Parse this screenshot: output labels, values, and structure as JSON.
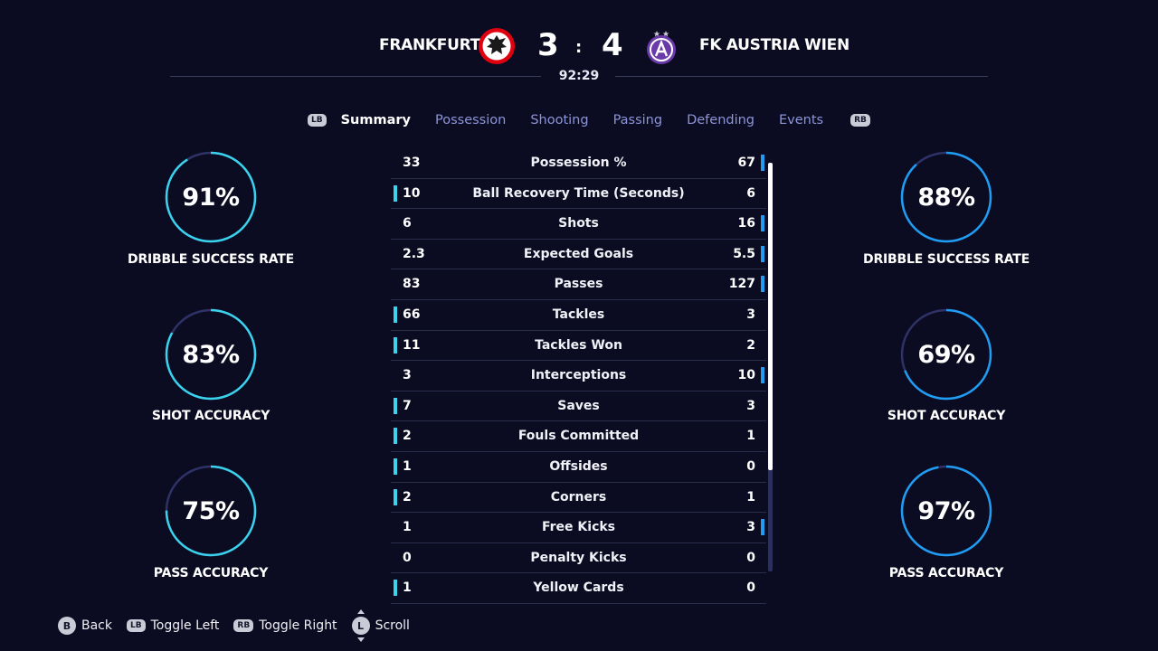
{
  "match": {
    "home_team": "FRANKFURT",
    "away_team": "FK AUSTRIA WIEN",
    "home_score": "3",
    "separator": ":",
    "away_score": "4",
    "clock": "92:29",
    "home_crest_icon": "eagle-crest-icon",
    "away_crest_icon": "violet-crest-icon"
  },
  "tabs": {
    "left_shoulder": "LB",
    "right_shoulder": "RB",
    "items": [
      "Summary",
      "Possession",
      "Shooting",
      "Passing",
      "Defending",
      "Events"
    ],
    "active": "Summary"
  },
  "colors": {
    "background": "#0b0b21",
    "home_accent": "#3ad3ee",
    "away_accent": "#1f9df2",
    "tab_inactive": "#8c95d9",
    "ring_track": "#2f3266"
  },
  "home_rings": [
    {
      "value": "91%",
      "label": "DRIBBLE SUCCESS RATE",
      "fraction": 0.91
    },
    {
      "value": "83%",
      "label": "SHOT ACCURACY",
      "fraction": 0.83
    },
    {
      "value": "75%",
      "label": "PASS ACCURACY",
      "fraction": 0.75
    }
  ],
  "away_rings": [
    {
      "value": "88%",
      "label": "DRIBBLE SUCCESS RATE",
      "fraction": 0.88
    },
    {
      "value": "69%",
      "label": "SHOT ACCURACY",
      "fraction": 0.69
    },
    {
      "value": "97%",
      "label": "PASS ACCURACY",
      "fraction": 0.97
    }
  ],
  "stats": [
    {
      "name": "Possession %",
      "home": "33",
      "away": "67",
      "leader": "away"
    },
    {
      "name": "Ball Recovery Time (Seconds)",
      "home": "10",
      "away": "6",
      "leader": "home"
    },
    {
      "name": "Shots",
      "home": "6",
      "away": "16",
      "leader": "away"
    },
    {
      "name": "Expected Goals",
      "home": "2.3",
      "away": "5.5",
      "leader": "away"
    },
    {
      "name": "Passes",
      "home": "83",
      "away": "127",
      "leader": "away"
    },
    {
      "name": "Tackles",
      "home": "66",
      "away": "3",
      "leader": "home"
    },
    {
      "name": "Tackles Won",
      "home": "11",
      "away": "2",
      "leader": "home"
    },
    {
      "name": "Interceptions",
      "home": "3",
      "away": "10",
      "leader": "away"
    },
    {
      "name": "Saves",
      "home": "7",
      "away": "3",
      "leader": "home"
    },
    {
      "name": "Fouls Committed",
      "home": "2",
      "away": "1",
      "leader": "home"
    },
    {
      "name": "Offsides",
      "home": "1",
      "away": "0",
      "leader": "home"
    },
    {
      "name": "Corners",
      "home": "2",
      "away": "1",
      "leader": "home"
    },
    {
      "name": "Free Kicks",
      "home": "1",
      "away": "3",
      "leader": "away"
    },
    {
      "name": "Penalty Kicks",
      "home": "0",
      "away": "0",
      "leader": "none"
    },
    {
      "name": "Yellow Cards",
      "home": "1",
      "away": "0",
      "leader": "home"
    }
  ],
  "footer": {
    "back_key": "B",
    "back_label": "Back",
    "toggle_left_key": "LB",
    "toggle_left_label": "Toggle Left",
    "toggle_right_key": "RB",
    "toggle_right_label": "Toggle Right",
    "scroll_key": "L",
    "scroll_label": "Scroll"
  }
}
